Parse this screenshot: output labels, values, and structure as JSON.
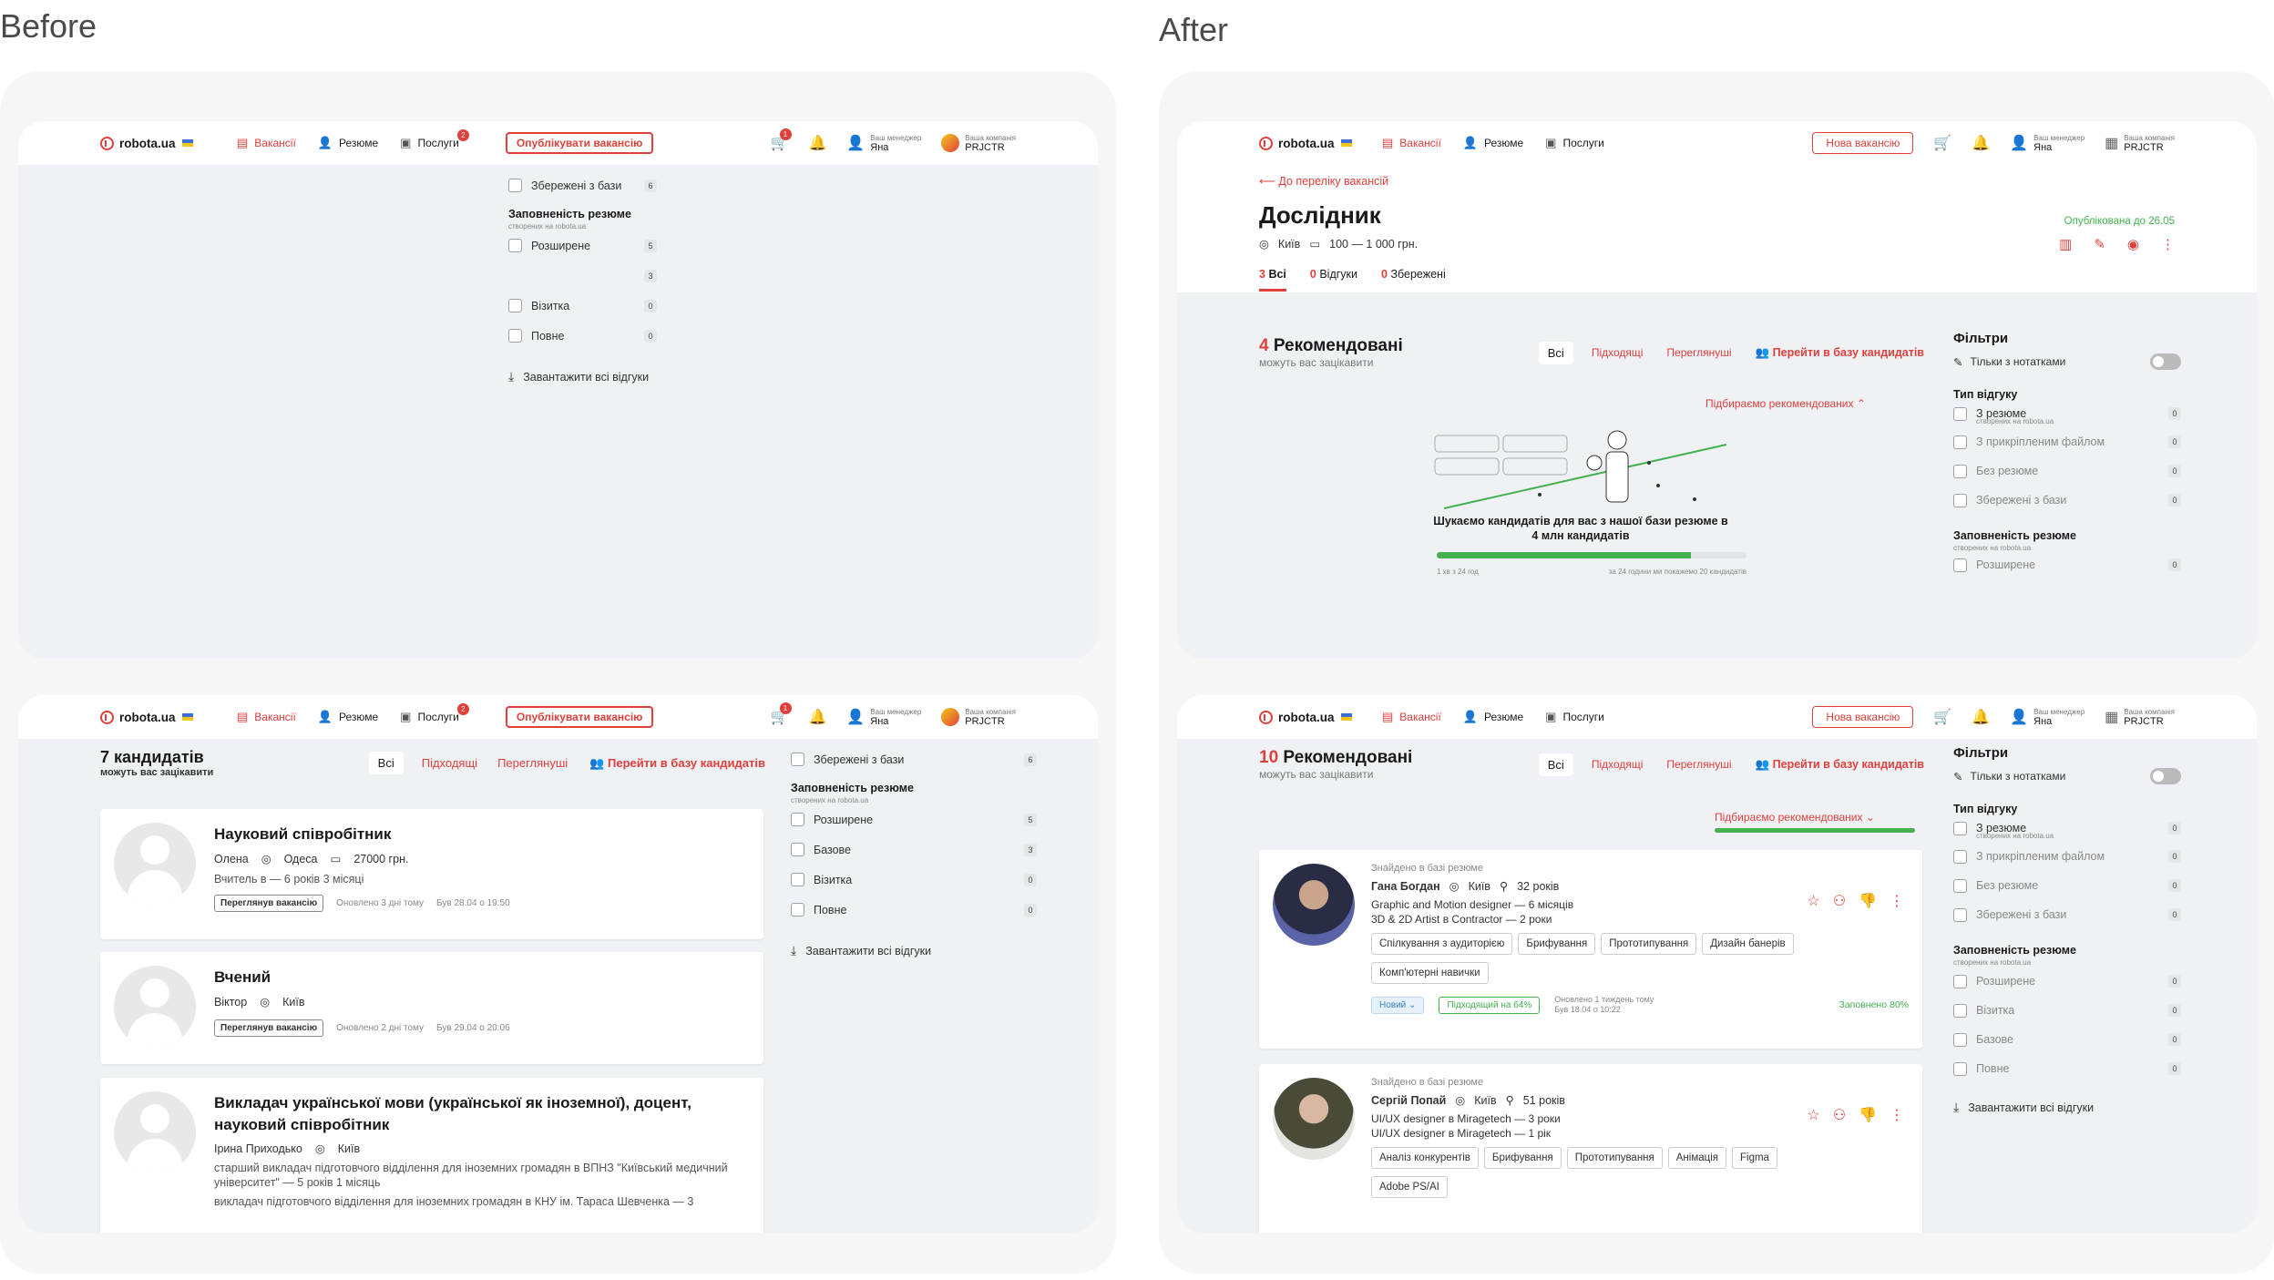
{
  "labels": {
    "before": "Before",
    "after": "After"
  },
  "nav": {
    "logo": "robota.ua",
    "vacancies": "Вакансії",
    "resumes": "Резюме",
    "services": "Послуги",
    "publish": "Опублікувати вакансію",
    "new_vacancy": "Нова вакансію",
    "manager_label": "Ваш менеджер",
    "manager_name": "Яна",
    "company_label": "Ваша компанія",
    "company_name": "PRJCTR",
    "cart_badge": "1",
    "services_badge": "2"
  },
  "filters": {
    "title": "Фільтри",
    "notes_only": "Тільки з нотатками",
    "type_title": "Тип відгуку",
    "with_resume": "З резюме",
    "created_on": "створених на robota.ua",
    "with_file": "З прикріпленим файлом",
    "no_resume": "Без резюме",
    "saved_from_db": "Збережені з бази",
    "fullness_title": "Заповненість резюме",
    "extended": "Розширене",
    "basic": "Базове",
    "card": "Візитка",
    "full": "Повне",
    "download_all": "Завантажити всі відгуки",
    "before_counts": {
      "saved": "6",
      "extended": "5",
      "basic": "3",
      "card": "0",
      "full": "0"
    },
    "after_counts": {
      "with_resume": "0",
      "with_file": "0",
      "no_resume": "0",
      "saved": "0",
      "extended": "0",
      "card": "0",
      "basic": "0",
      "full": "0"
    }
  },
  "before_list": {
    "count_title": "7 кандидатів",
    "subtitle": "можуть вас зацікавити",
    "tab_all": "Всі",
    "tab_fit": "Підходящі",
    "tab_viewed": "Переглянуші",
    "goto_db": "Перейти в базу кандидатів",
    "cards": [
      {
        "title": "Науковий співробітник",
        "name": "Олена",
        "city": "Одеса",
        "salary": "27000 грн.",
        "exp": "Вчитель в — 6 років 3 місяці",
        "btn": "Переглянув вакансію",
        "updated": "Оновлено 3 дні тому",
        "seen": "Був 28.04 о 19:50"
      },
      {
        "title": "Вчений",
        "name": "Віктор",
        "city": "Київ",
        "btn": "Переглянув вакансію",
        "updated": "Оновлено 2 дні тому",
        "seen": "Був 29.04 о 20:06"
      },
      {
        "title": "Викладач української мови (української як іноземної), доцент, науковий співробітник",
        "name": "Ірина Приходько",
        "city": "Київ",
        "exp": "старший викладач підготовчого відділення для іноземних громадян в ВПНЗ \"Київський медичний університет\" — 5 років 1 місяць",
        "exp2": "викладач підготовчого відділення для іноземних громадян в КНУ ім. Тараса Шевченка — 3"
      }
    ]
  },
  "after_vacancy": {
    "back": "До переліку вакансій",
    "title": "Дослідник",
    "city": "Київ",
    "salary": "100 — 1 000 грн.",
    "published": "Опублікована до 26.05",
    "tab_all_n": "3",
    "tab_all": "Всі",
    "tab_resp_n": "0",
    "tab_resp": "Відгуки",
    "tab_saved_n": "0",
    "tab_saved": "Збережені",
    "rec_n": "4",
    "rec_title": "Рекомендовані",
    "rec_sub": "можуть вас зацікавити",
    "picking": "Підбираємо рекомендованих",
    "search_text": "Шукаємо кандидатів для вас з нашої бази резюме в 4 млн кандидатів",
    "progress": 0.82,
    "time_left": "1 хв з 24 год",
    "promise": "за 24 години ми покажемо 20 кандидатів"
  },
  "after_list": {
    "rec_n": "10",
    "rec_title": "Рекомендовані",
    "cards": [
      {
        "found": "Знайдено в базі резюме",
        "name": "Гана Богдан",
        "city": "Київ",
        "age": "32 років",
        "exp1": "Graphic and Motion designer — 6 місяців",
        "exp2": "3D & 2D Artist в Contractor — 2 роки",
        "skills": [
          "Спілкування з аудиторією",
          "Брифування",
          "Прототипування",
          "Дизайн банерів",
          "Комп'ютерні навички"
        ],
        "status": "Новий",
        "fit": "Підходящий на 64%",
        "updated": "Оновлено 1 тиждень тому",
        "seen": "Був 18.04 о 10:22",
        "filled": "Заповнено 80%"
      },
      {
        "found": "Знайдено в базі резюме",
        "name": "Сергій Попай",
        "city": "Київ",
        "age": "51 років",
        "exp1": "UI/UX designer в Miragetech — 3 роки",
        "exp2": "UI/UX designer в Miragetech — 1 рік",
        "skills": [
          "Аналіз конкурентів",
          "Брифування",
          "Прототипування",
          "Анімація",
          "Figma",
          "Adobe PS/AI"
        ]
      }
    ]
  },
  "colors": {
    "accent": "#e0403b",
    "green": "#43b14f"
  }
}
